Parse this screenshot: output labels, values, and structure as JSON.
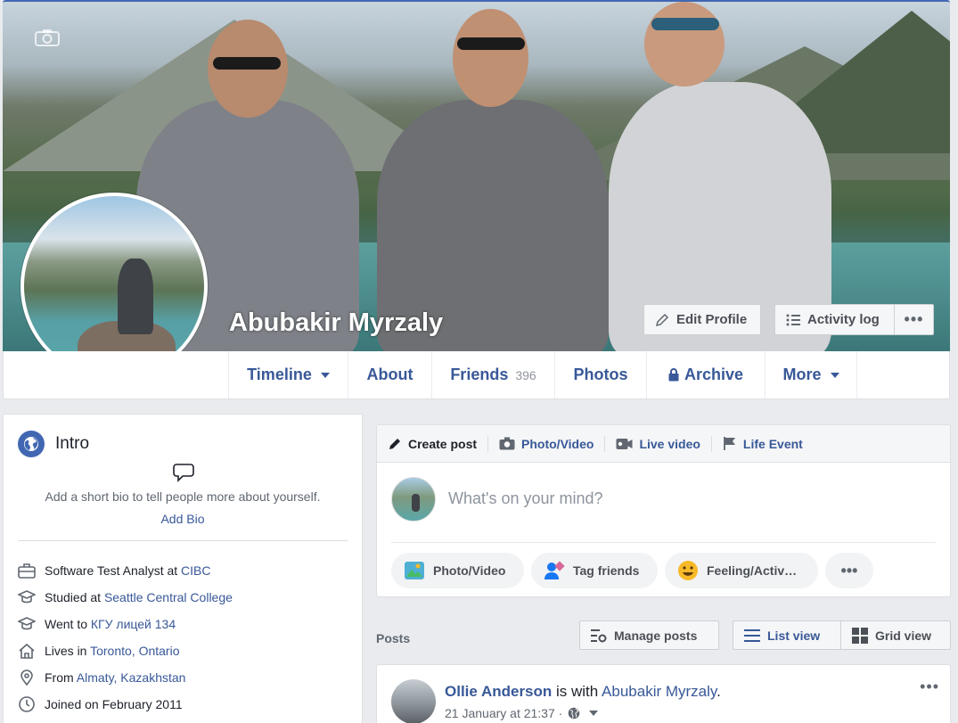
{
  "profile": {
    "name": "Abubakir Myrzaly",
    "edit_profile": "Edit Profile",
    "activity_log": "Activity log",
    "more_dots": "•••"
  },
  "nav": {
    "timeline": "Timeline",
    "about": "About",
    "friends": "Friends",
    "friends_count": "396",
    "photos": "Photos",
    "archive": "Archive",
    "more": "More"
  },
  "intro": {
    "title": "Intro",
    "bio_prompt": "Add a short bio to tell people more about yourself.",
    "add_bio": "Add Bio",
    "items": [
      {
        "prefix": "Software Test Analyst at ",
        "link": "CIBC",
        "icon": "briefcase-icon"
      },
      {
        "prefix": "Studied at ",
        "link": "Seattle Central College",
        "icon": "graduation-cap-icon"
      },
      {
        "prefix": "Went to ",
        "link": "КГУ лицей 134",
        "icon": "graduation-cap-icon"
      },
      {
        "prefix": "Lives in ",
        "link": "Toronto, Ontario",
        "icon": "house-icon"
      },
      {
        "prefix": "From ",
        "link": "Almaty, Kazakhstan",
        "icon": "map-pin-icon"
      },
      {
        "prefix": "Joined on February 2011",
        "link": "",
        "icon": "clock-icon"
      }
    ]
  },
  "composer": {
    "tabs": {
      "create_post": "Create post",
      "photo_video": "Photo/Video",
      "live_video": "Live video",
      "life_event": "Life Event"
    },
    "placeholder": "What's on your mind?",
    "actions": {
      "photo_video": "Photo/Video",
      "tag_friends": "Tag friends",
      "feeling": "Feeling/Activ…",
      "more": "•••"
    }
  },
  "posts": {
    "label": "Posts",
    "manage": "Manage posts",
    "list_view": "List view",
    "grid_view": "Grid view"
  },
  "post": {
    "author": "Ollie Anderson",
    "with_text": " is with ",
    "tagged": "Abubakir Myrzaly",
    "end": ".",
    "date": "21 January at 21:37 ·",
    "menu": "•••"
  },
  "colors": {
    "brand": "#4267b2",
    "link": "#385898",
    "background": "#e9ebee"
  }
}
